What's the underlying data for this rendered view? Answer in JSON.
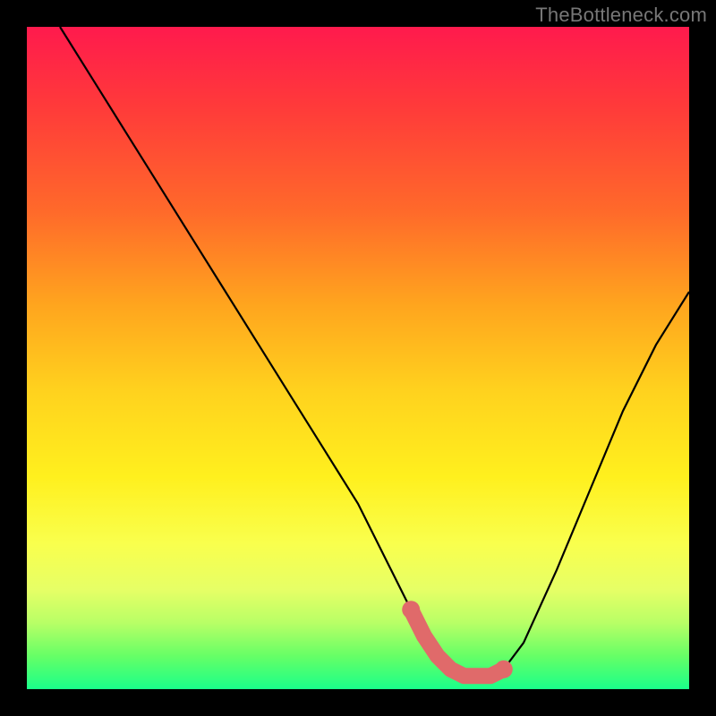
{
  "watermark": "TheBottleneck.com",
  "colors": {
    "frame": "#000000",
    "curve_stroke": "#000000",
    "marker_stroke": "#e06a6a",
    "marker_fill": "#e06a6a"
  },
  "chart_data": {
    "type": "line",
    "title": "",
    "xlabel": "",
    "ylabel": "",
    "xlim": [
      0,
      100
    ],
    "ylim": [
      0,
      100
    ],
    "grid": false,
    "legend": false,
    "series": [
      {
        "name": "bottleneck-curve",
        "x": [
          5,
          10,
          15,
          20,
          25,
          30,
          35,
          40,
          45,
          50,
          55,
          58,
          60,
          62,
          64,
          66,
          68,
          70,
          72,
          75,
          80,
          85,
          90,
          95,
          100
        ],
        "y": [
          100,
          92,
          84,
          76,
          68,
          60,
          52,
          44,
          36,
          28,
          18,
          12,
          8,
          5,
          3,
          2,
          2,
          2,
          3,
          7,
          18,
          30,
          42,
          52,
          60
        ]
      }
    ],
    "markers": {
      "name": "highlight-segment",
      "x": [
        58,
        60,
        62,
        64,
        66,
        68,
        70,
        72
      ],
      "y": [
        12,
        8,
        5,
        3,
        2,
        2,
        2,
        3
      ]
    },
    "gradient_stops": [
      {
        "pos": 0,
        "color": "#ff1a4d"
      },
      {
        "pos": 12,
        "color": "#ff3a3a"
      },
      {
        "pos": 28,
        "color": "#ff6a2a"
      },
      {
        "pos": 42,
        "color": "#ffa51e"
      },
      {
        "pos": 55,
        "color": "#ffd21e"
      },
      {
        "pos": 68,
        "color": "#fff01e"
      },
      {
        "pos": 78,
        "color": "#f9ff4d"
      },
      {
        "pos": 85,
        "color": "#e6ff66"
      },
      {
        "pos": 90,
        "color": "#b8ff66"
      },
      {
        "pos": 95,
        "color": "#66ff66"
      },
      {
        "pos": 100,
        "color": "#1aff8a"
      }
    ]
  }
}
